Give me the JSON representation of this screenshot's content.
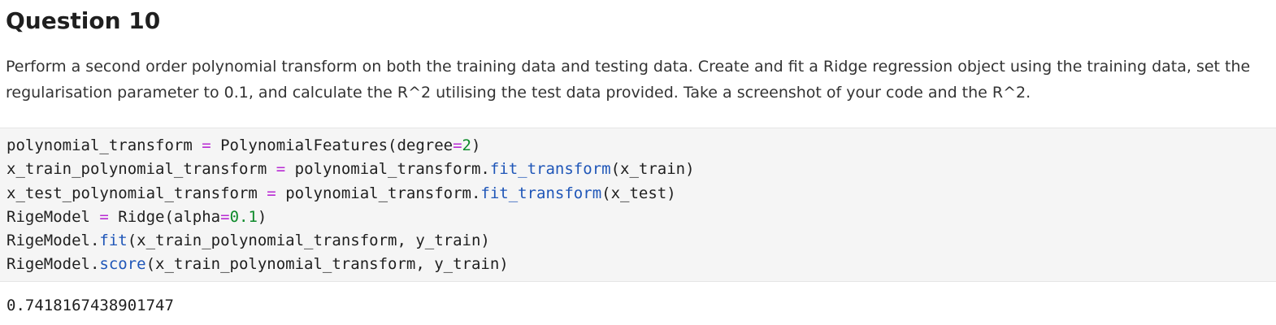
{
  "heading": "Question 10",
  "paragraph": {
    "line1": "Perform a second order polynomial transform on both the training data and testing data. Create and fit a Ridge regression object using the training data, set the",
    "line2": "regularisation parameter to 0.1, and calculate the R^2 utilising the test data provided. Take a screenshot of your code and the R^2."
  },
  "code": {
    "line1": {
      "a": "polynomial_transform ",
      "op": "=",
      "b": " PolynomialFeatures(degree",
      "op2": "=",
      "num": "2",
      "c": ")"
    },
    "line2": {
      "a": "x_train_polynomial_transform ",
      "op": "=",
      "b": " polynomial_transform.",
      "fn": "fit_transform",
      "c": "(x_train)"
    },
    "line3": {
      "a": "x_test_polynomial_transform ",
      "op": "=",
      "b": " polynomial_transform.",
      "fn": "fit_transform",
      "c": "(x_test)"
    },
    "line4": {
      "a": "RigeModel ",
      "op": "=",
      "b": " Ridge(alpha",
      "op2": "=",
      "num": "0.1",
      "c": ")"
    },
    "line5": {
      "a": "RigeModel.",
      "fn": "fit",
      "c": "(x_train_polynomial_transform, y_train)"
    },
    "line6": {
      "a": "RigeModel.",
      "fn": "score",
      "c": "(x_train_polynomial_transform, y_train)"
    }
  },
  "output": "0.7418167438901747",
  "colors": {
    "operator": "#b82ad3",
    "number": "#0d8a2a",
    "function": "#1f56b8",
    "code_background": "#f5f5f5"
  }
}
